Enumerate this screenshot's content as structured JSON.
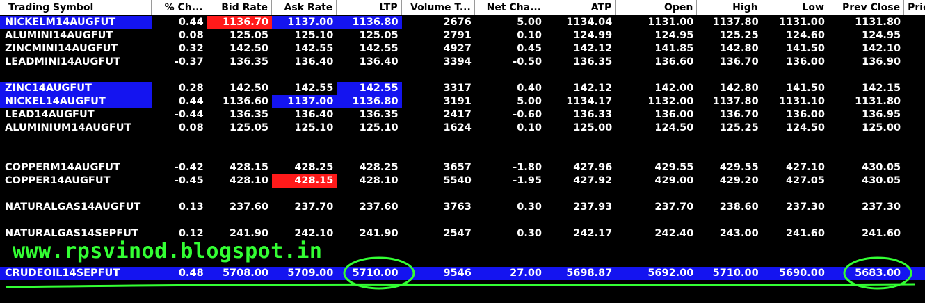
{
  "columns": [
    {
      "key": "symbol",
      "label": "Trading Symbol",
      "width": 220,
      "align": "left"
    },
    {
      "key": "pct",
      "label": "% Ch...",
      "width": 80,
      "align": "right"
    },
    {
      "key": "bid",
      "label": "Bid Rate",
      "width": 94,
      "align": "right"
    },
    {
      "key": "ask",
      "label": "Ask Rate",
      "width": 94,
      "align": "right"
    },
    {
      "key": "ltp",
      "label": "LTP",
      "width": 94,
      "align": "right"
    },
    {
      "key": "vol",
      "label": "Volume T...",
      "width": 106,
      "align": "right"
    },
    {
      "key": "net",
      "label": "Net Cha...",
      "width": 102,
      "align": "right"
    },
    {
      "key": "atp",
      "label": "ATP",
      "width": 102,
      "align": "right"
    },
    {
      "key": "open",
      "label": "Open",
      "width": 118,
      "align": "right"
    },
    {
      "key": "high",
      "label": "High",
      "width": 94,
      "align": "right"
    },
    {
      "key": "low",
      "label": "Low",
      "width": 96,
      "align": "right"
    },
    {
      "key": "prev",
      "label": "Prev Close",
      "width": 110,
      "align": "right"
    },
    {
      "key": "pri",
      "label": "Pric",
      "width": 30,
      "align": "left"
    }
  ],
  "rows": [
    {
      "slot": 0,
      "symbol": "NICKELM14AUGFUT",
      "pct": "0.44",
      "bid": "1136.70",
      "ask": "1137.00",
      "ltp": "1136.80",
      "vol": "2676",
      "net": "5.00",
      "atp": "1134.04",
      "open": "1131.00",
      "high": "1137.80",
      "low": "1131.00",
      "prev": "1131.80",
      "pri": "",
      "hl": {
        "symbol": "blue",
        "bid": "red",
        "ask": "blue",
        "ltp": "blue"
      }
    },
    {
      "slot": 1,
      "symbol": "ALUMINI14AUGFUT",
      "pct": "0.08",
      "bid": "125.05",
      "ask": "125.10",
      "ltp": "125.05",
      "vol": "2791",
      "net": "0.10",
      "atp": "124.99",
      "open": "124.95",
      "high": "125.25",
      "low": "124.60",
      "prev": "124.95",
      "pri": ""
    },
    {
      "slot": 2,
      "symbol": "ZINCMINI14AUGFUT",
      "pct": "0.32",
      "bid": "142.50",
      "ask": "142.55",
      "ltp": "142.55",
      "vol": "4927",
      "net": "0.45",
      "atp": "142.12",
      "open": "141.85",
      "high": "142.80",
      "low": "141.50",
      "prev": "142.10",
      "pri": ""
    },
    {
      "slot": 3,
      "symbol": "LEADMINI14AUGFUT",
      "pct": "-0.37",
      "bid": "136.35",
      "ask": "136.40",
      "ltp": "136.40",
      "vol": "3394",
      "net": "-0.50",
      "atp": "136.35",
      "open": "136.60",
      "high": "136.70",
      "low": "136.00",
      "prev": "136.90",
      "pri": ""
    },
    {
      "slot": 5,
      "symbol": "ZINC14AUGFUT",
      "pct": "0.28",
      "bid": "142.50",
      "ask": "142.55",
      "ltp": "142.55",
      "vol": "3317",
      "net": "0.40",
      "atp": "142.12",
      "open": "142.00",
      "high": "142.80",
      "low": "141.50",
      "prev": "142.15",
      "pri": "",
      "hl": {
        "symbol": "blue",
        "ltp": "blue"
      }
    },
    {
      "slot": 6,
      "symbol": "NICKEL14AUGFUT",
      "pct": "0.44",
      "bid": "1136.60",
      "ask": "1137.00",
      "ltp": "1136.80",
      "vol": "3191",
      "net": "5.00",
      "atp": "1134.17",
      "open": "1132.00",
      "high": "1137.80",
      "low": "1131.10",
      "prev": "1131.80",
      "pri": "",
      "hl": {
        "symbol": "blue",
        "ask": "blue",
        "ltp": "blue"
      }
    },
    {
      "slot": 7,
      "symbol": "LEAD14AUGFUT",
      "pct": "-0.44",
      "bid": "136.35",
      "ask": "136.40",
      "ltp": "136.35",
      "vol": "2417",
      "net": "-0.60",
      "atp": "136.33",
      "open": "136.00",
      "high": "136.70",
      "low": "136.00",
      "prev": "136.95",
      "pri": ""
    },
    {
      "slot": 8,
      "symbol": "ALUMINIUM14AUGFUT",
      "pct": "0.08",
      "bid": "125.05",
      "ask": "125.10",
      "ltp": "125.10",
      "vol": "1624",
      "net": "0.10",
      "atp": "125.00",
      "open": "124.50",
      "high": "125.25",
      "low": "124.50",
      "prev": "125.00",
      "pri": ""
    },
    {
      "slot": 11,
      "symbol": "COPPERM14AUGFUT",
      "pct": "-0.42",
      "bid": "428.15",
      "ask": "428.25",
      "ltp": "428.25",
      "vol": "3657",
      "net": "-1.80",
      "atp": "427.96",
      "open": "429.55",
      "high": "429.55",
      "low": "427.10",
      "prev": "430.05",
      "pri": ""
    },
    {
      "slot": 12,
      "symbol": "COPPER14AUGFUT",
      "pct": "-0.45",
      "bid": "428.10",
      "ask": "428.15",
      "ltp": "428.10",
      "vol": "5540",
      "net": "-1.95",
      "atp": "427.92",
      "open": "429.00",
      "high": "429.20",
      "low": "427.05",
      "prev": "430.05",
      "pri": "",
      "hl": {
        "ask": "red"
      }
    },
    {
      "slot": 14,
      "symbol": "NATURALGAS14AUGFUT",
      "pct": "0.13",
      "bid": "237.60",
      "ask": "237.70",
      "ltp": "237.60",
      "vol": "3763",
      "net": "0.30",
      "atp": "237.93",
      "open": "237.70",
      "high": "238.60",
      "low": "237.30",
      "prev": "237.30",
      "pri": ""
    },
    {
      "slot": 16,
      "symbol": "NATURALGAS14SEPFUT",
      "pct": "0.12",
      "bid": "241.90",
      "ask": "242.10",
      "ltp": "241.90",
      "vol": "2547",
      "net": "0.30",
      "atp": "242.17",
      "open": "242.40",
      "high": "243.00",
      "low": "241.60",
      "prev": "241.60",
      "pri": ""
    },
    {
      "slot": 19,
      "symbol": "CRUDEOIL14SEPFUT",
      "pct": "0.48",
      "bid": "5708.00",
      "ask": "5709.00",
      "ltp": "5710.00",
      "vol": "9546",
      "net": "27.00",
      "atp": "5698.87",
      "open": "5692.00",
      "high": "5710.00",
      "low": "5690.00",
      "prev": "5683.00",
      "pri": "",
      "full": true
    }
  ],
  "watermark": "www.rpsvinod.blogspot.in",
  "colors": {
    "background": "#000000",
    "header_bg": "#ffffff",
    "highlight_blue": "#1414f0",
    "highlight_red": "#ff1a1a",
    "annotation_green": "#33ff33"
  }
}
